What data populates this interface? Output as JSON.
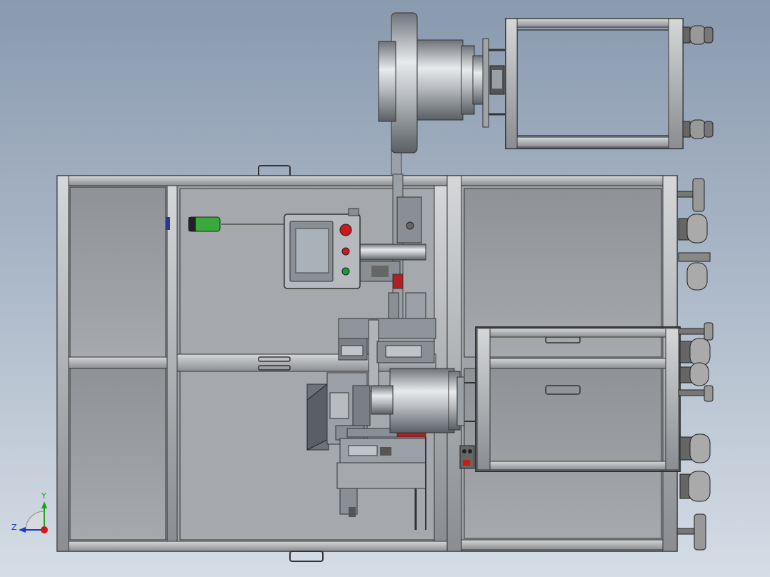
{
  "view": {
    "background_top": "#8a9aaf",
    "background_bottom": "#d5dde6"
  },
  "triad": {
    "y_label": "Y",
    "z_label": "Z",
    "y_color": "#1aa01a",
    "z_color": "#1a3ac8",
    "x_color": "#d01818"
  },
  "hmi": {
    "emergency_stop_color": "#cc1a1a",
    "green_button_color": "#1a9a3a",
    "sensor_color": "#3aa83a"
  }
}
